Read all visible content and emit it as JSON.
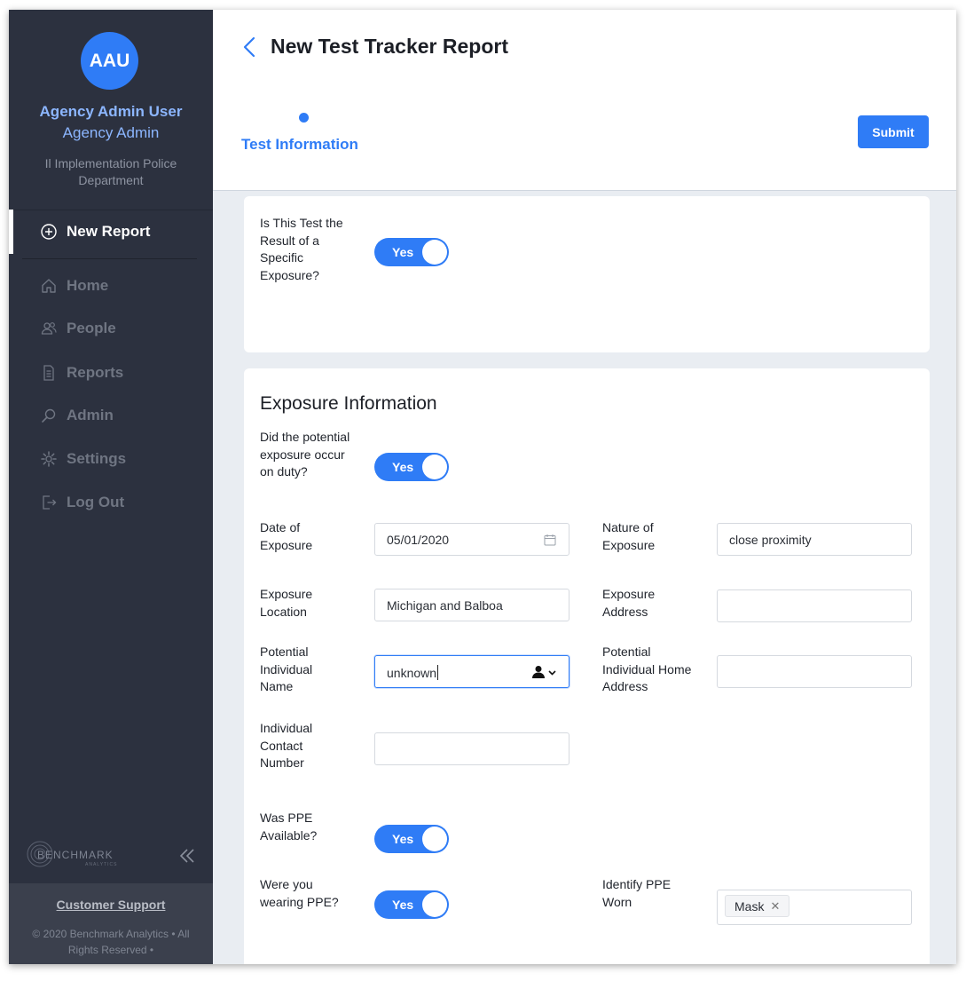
{
  "sidebar": {
    "avatar_initials": "AAU",
    "user_name": "Agency Admin User",
    "user_role": "Agency Admin",
    "agency": "Il Implementation Police Department",
    "nav": [
      {
        "label": "New Report",
        "icon": "plus-circle-icon",
        "active": true
      },
      {
        "label": "Home",
        "icon": "home-icon"
      },
      {
        "label": "People",
        "icon": "people-icon"
      },
      {
        "label": "Reports",
        "icon": "document-icon"
      },
      {
        "label": "Admin",
        "icon": "search-icon"
      },
      {
        "label": "Settings",
        "icon": "gear-icon"
      },
      {
        "label": "Log Out",
        "icon": "logout-icon"
      }
    ],
    "brand": "BENCHMARK",
    "brand_sub": "ANALYTICS",
    "support": "Customer Support",
    "copyright": "© 2020 Benchmark Analytics • All Rights Reserved •"
  },
  "header": {
    "title": "New Test Tracker Report",
    "step_label": "Test Information",
    "submit_label": "Submit"
  },
  "form": {
    "specific_exposure": {
      "label": "Is This Test the Result of a Specific Exposure?",
      "value": "Yes"
    },
    "section_title": "Exposure Information",
    "on_duty": {
      "label": "Did the potential exposure occur on duty?",
      "value": "Yes"
    },
    "date_of_exposure": {
      "label": "Date of Exposure",
      "value": "05/01/2020"
    },
    "nature_of_exposure": {
      "label": "Nature of Exposure",
      "value": "close proximity"
    },
    "exposure_location": {
      "label": "Exposure Location",
      "value": "Michigan and Balboa"
    },
    "exposure_address": {
      "label": "Exposure Address",
      "value": ""
    },
    "potential_individual_name": {
      "label": "Potential Individual Name",
      "value": "unknown"
    },
    "potential_individual_home_address": {
      "label": "Potential Individual Home Address",
      "value": ""
    },
    "individual_contact_number": {
      "label": "Individual Contact Number",
      "value": ""
    },
    "ppe_available": {
      "label": "Was PPE Available?",
      "value": "Yes"
    },
    "wearing_ppe": {
      "label": "Were you wearing PPE?",
      "value": "Yes"
    },
    "identify_ppe_worn": {
      "label": "Identify PPE Worn",
      "tags": [
        "Mask"
      ]
    }
  },
  "colors": {
    "accent": "#2f7cf6",
    "sidebar_bg": "#2c313f",
    "page_bg": "#e9edf2"
  }
}
